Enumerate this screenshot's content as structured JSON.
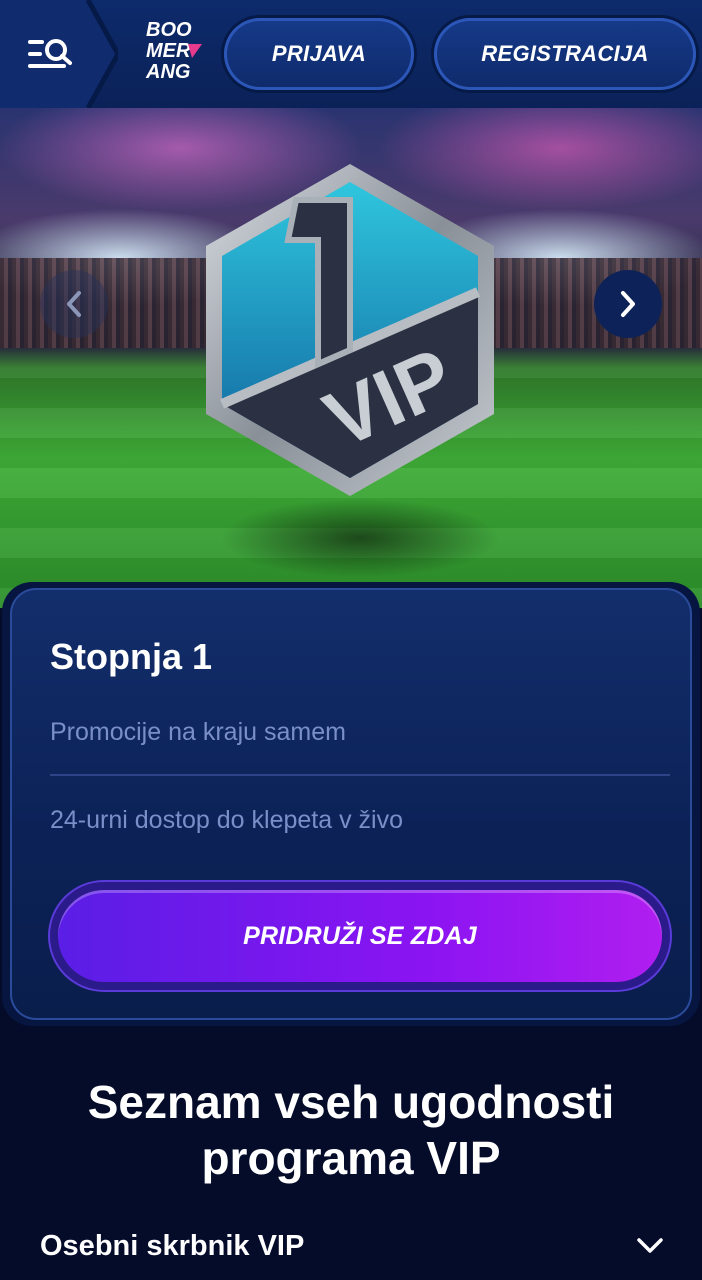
{
  "header": {
    "logo_lines": [
      "BOO",
      "MER",
      "ANG"
    ],
    "login_label": "PRIJAVA",
    "register_label": "REGISTRACIJA",
    "menu_icon": "menu-search-icon"
  },
  "hero": {
    "badge_number": "1",
    "badge_text": "VIP",
    "prev_icon": "chevron-left-icon",
    "next_icon": "chevron-right-icon"
  },
  "card": {
    "title": "Stopnja 1",
    "benefits": [
      "Promocije na kraju samem",
      "24-urni dostop do klepeta v živo"
    ],
    "cta_label": "PRIDRUŽI SE ZDAJ"
  },
  "section": {
    "title_line1": "Seznam vseh ugodnosti",
    "title_line2": "programa VIP",
    "accordion_label": "Osebni skrbnik VIP",
    "accordion_icon": "chevron-down-icon"
  },
  "colors": {
    "background": "#050c2a",
    "header": "#0d2a6b",
    "card": "#0c2257",
    "cta_start": "#5a1ee6",
    "cta_end": "#b01ef0",
    "muted_text": "#7a8fc8",
    "logo_accent": "#e83a8c"
  }
}
